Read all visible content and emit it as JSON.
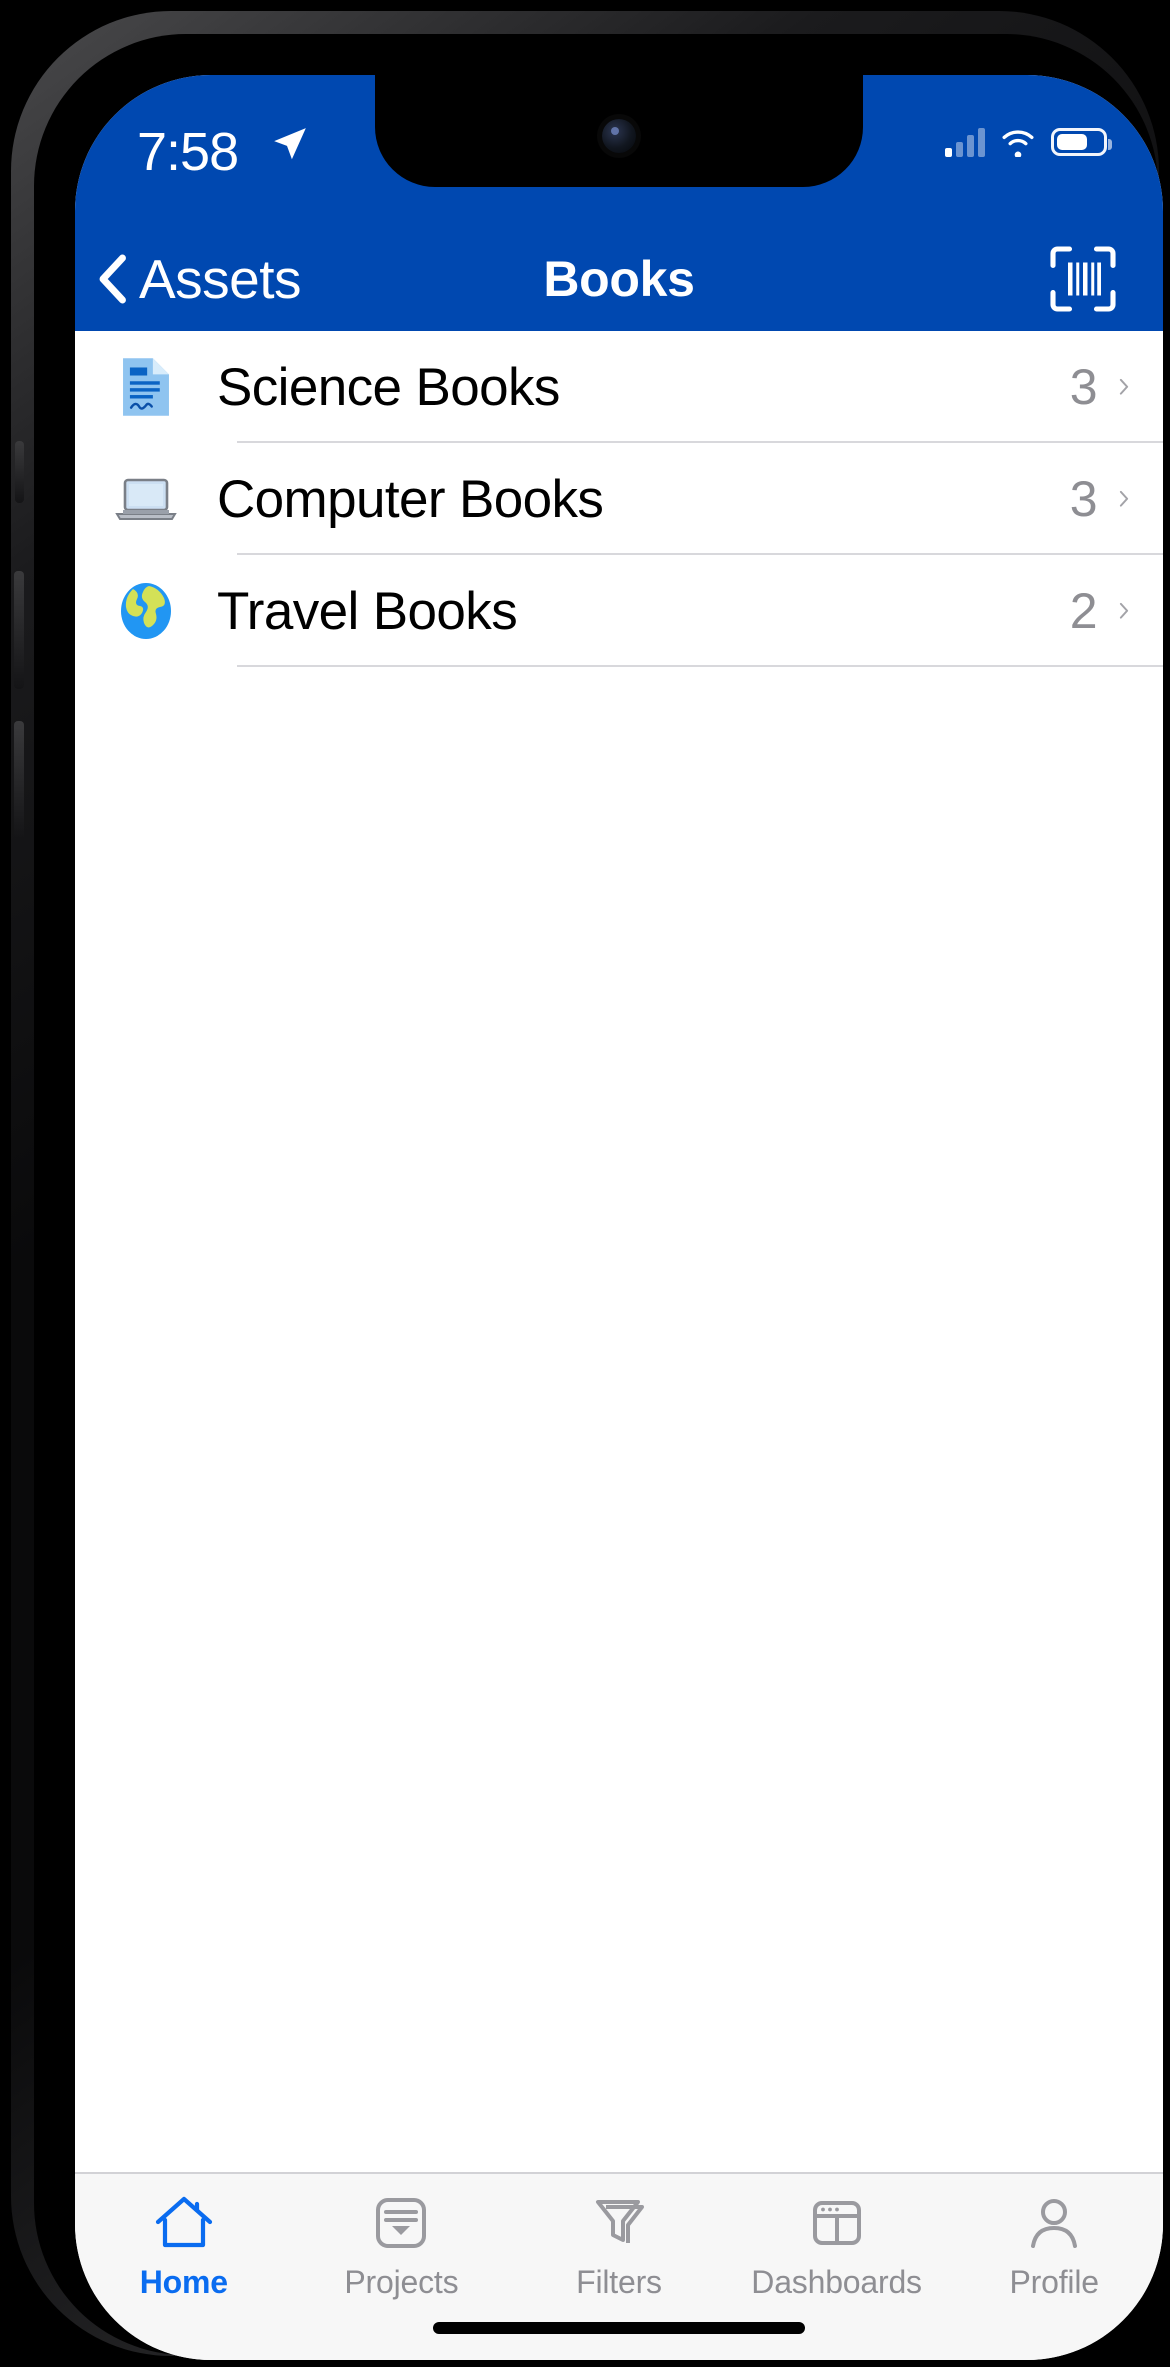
{
  "theme": {
    "brand_blue": "#0048b0",
    "accent_blue": "#0a6cf0",
    "inactive_gray": "#8e8e93",
    "separator": "#d8d8dc",
    "tabbar_bg": "#f7f7f7"
  },
  "status_bar": {
    "time": "7:58",
    "location_icon": "location-arrow-icon",
    "cellular_icon": "cellular-signal-icon",
    "cellular_bars_filled": 1,
    "cellular_bars_total": 4,
    "wifi_icon": "wifi-icon",
    "battery_icon": "battery-icon",
    "battery_level_percent": 60
  },
  "nav_bar": {
    "back_label": "Assets",
    "back_icon": "chevron-left-icon",
    "title": "Books",
    "scan_icon": "barcode-scanner-icon"
  },
  "list": {
    "rows": [
      {
        "icon": "page-with-curl-icon",
        "emoji": "📄",
        "label": "Science Books",
        "count": "3",
        "chevron": "chevron-right-icon"
      },
      {
        "icon": "laptop-icon",
        "emoji": "💻",
        "label": "Computer Books",
        "count": "3",
        "chevron": "chevron-right-icon"
      },
      {
        "icon": "globe-icon",
        "emoji": "🌍",
        "label": "Travel Books",
        "count": "2",
        "chevron": "chevron-right-icon"
      }
    ]
  },
  "tab_bar": {
    "active_index": 0,
    "tabs": [
      {
        "label": "Home",
        "icon": "house-icon"
      },
      {
        "label": "Projects",
        "icon": "window-list-icon"
      },
      {
        "label": "Filters",
        "icon": "funnel-icon"
      },
      {
        "label": "Dashboards",
        "icon": "dashboard-window-icon"
      },
      {
        "label": "Profile",
        "icon": "person-icon"
      }
    ]
  }
}
